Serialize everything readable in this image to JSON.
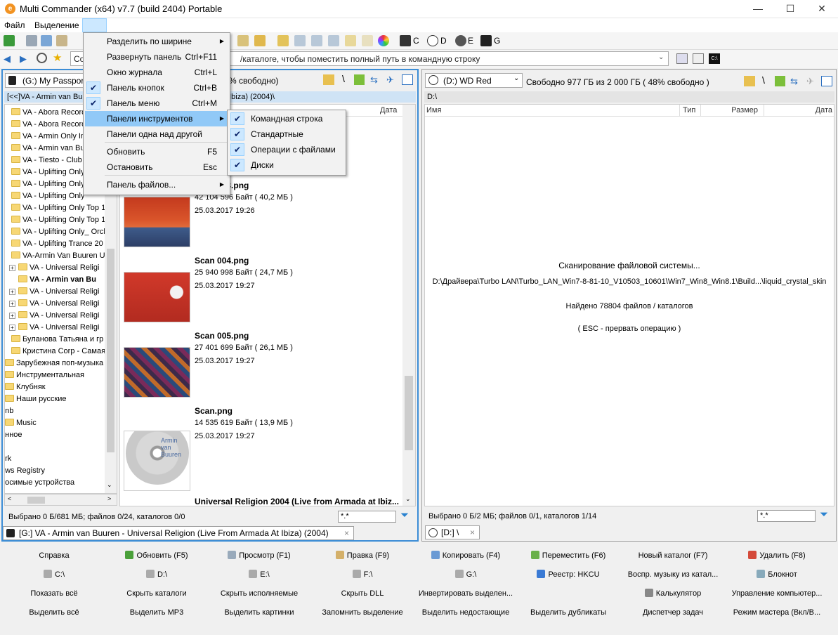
{
  "window": {
    "title": "Multi Commander (x64)  v7.7 (build 2404) Portable",
    "minimize": "—",
    "maximize": "☐",
    "close": "✕"
  },
  "menubar": {
    "file": "Файл",
    "selection": "Выделение"
  },
  "toolbar": {
    "drives": [
      "C",
      "D",
      "E",
      "G"
    ]
  },
  "cmdline": {
    "text": "Co",
    "hint": "/каталоге, чтобы поместить полный путь в командную строку"
  },
  "left": {
    "drive": "(G:) My Passport",
    "free": "% свободно)",
    "path_prefix": "[<<]VA - Armin van Bu",
    "path_suffix": "t Ibiza) (2004)\\",
    "col_date": "Дата",
    "tree": [
      {
        "label": "VA - Abora Record",
        "indent": 1
      },
      {
        "label": "VA - Abora Record",
        "indent": 1
      },
      {
        "label": "VA - Armin Only Int",
        "indent": 1
      },
      {
        "label": "VA - Armin van Bu",
        "indent": 1
      },
      {
        "label": "VA - Tiesto - Club L",
        "indent": 1
      },
      {
        "label": "VA - Uplifting Only",
        "indent": 1
      },
      {
        "label": "VA - Uplifting Only",
        "indent": 1
      },
      {
        "label": "VA - Uplifting Only",
        "indent": 1
      },
      {
        "label": "VA - Uplifting Only Top 1",
        "indent": 1
      },
      {
        "label": "VA - Uplifting Only Top 1",
        "indent": 1
      },
      {
        "label": "VA - Uplifting Only_ Orch",
        "indent": 1
      },
      {
        "label": "VA - Uplifting Trance 20",
        "indent": 1
      },
      {
        "label": "VA-Armin Van Buuren Ui",
        "indent": 1
      },
      {
        "label": "VA  - Universal Religi",
        "indent": 2,
        "plus": true
      },
      {
        "label": "VA - Armin van Bu",
        "indent": 2,
        "bold": true
      },
      {
        "label": "VA - Universal Religi",
        "indent": 2,
        "plus": true
      },
      {
        "label": "VA - Universal Religi",
        "indent": 2,
        "plus": true
      },
      {
        "label": "VA - Universal Religi",
        "indent": 2,
        "plus": true
      },
      {
        "label": "VA - Universal Religi",
        "indent": 2,
        "plus": true
      },
      {
        "label": "Буланова Татьяна и гр",
        "indent": 1
      },
      {
        "label": "Кристина Corp -  Самая",
        "indent": 1
      },
      {
        "label": "Зарубежная поп-музыка",
        "indent": 0
      },
      {
        "label": "Инструментальная",
        "indent": 0
      },
      {
        "label": "Клубняк",
        "indent": 0
      },
      {
        "label": "Наши русские",
        "indent": 0
      },
      {
        "label": "enb",
        "indent": -1
      },
      {
        "label": "Music",
        "indent": 0
      },
      {
        "label": "анное",
        "indent": -1
      },
      {
        "label": "",
        "indent": -1
      },
      {
        "label": "ork",
        "indent": -1
      },
      {
        "label": "ows Registry",
        "indent": -1
      },
      {
        "label": "носимые устройства",
        "indent": -1
      }
    ],
    "files": [
      {
        "name": "Scan 003.png",
        "size": "42 104 596 Байт ( 40,2 МБ )",
        "date": "25.03.2017 19:26",
        "thumb": "red"
      },
      {
        "name": "Scan 004.png",
        "size": "25 940 998 Байт ( 24,7 МБ )",
        "date": "25.03.2017 19:27",
        "thumb": "redbook"
      },
      {
        "name": "Scan 005.png",
        "size": "27 401 699 Байт ( 26,1 МБ )",
        "date": "25.03.2017 19:27",
        "thumb": "collage"
      },
      {
        "name": "Scan.png",
        "size": "14 535 619 Байт ( 13,9 МБ )",
        "date": "25.03.2017 19:27",
        "thumb": "cd"
      }
    ],
    "cd_text": "Armin van Buuren",
    "last_file": "Universal Religion 2004 (Live from Armada at Ibiz...",
    "status": "Выбрано 0 Б/681 МБ; файлов 0/24, каталогов 0/0",
    "filter": "*.*",
    "tab": "[G:] VA - Armin van Buuren - Universal Religion (Live From Armada At Ibiza) (2004)",
    "tab_close": "×"
  },
  "right": {
    "drive": "(D:) WD Red",
    "free": "Свободно 977 ГБ из 2 000 ГБ ( 48% свободно )",
    "path": "D:\\",
    "col_name": "Имя",
    "col_type": "Тип",
    "col_size": "Размер",
    "col_date": "Дата",
    "scan_title": "Сканирование файловой системы...",
    "scan_path": "D:\\Драйвера\\Turbo LAN\\Turbo_LAN_Win7-8-81-10_V10503_10601\\Win7_Win8_Win8.1\\Build...\\liquid_crystal_skin",
    "scan_found": "Найдено 78804 файлов / каталогов",
    "scan_esc": "( ESC - прервать операцию )",
    "status": "Выбрано 0 Б/2 МБ; файлов 0/1, каталогов 1/14",
    "filter": "*.*",
    "tab": "[D:] \\",
    "tab_close": "×"
  },
  "fnbar": {
    "rows": [
      [
        "Справка",
        "Обновить (F5)",
        "Просмотр (F1)",
        "Правка (F9)",
        "Копировать (F4)",
        "Переместить (F6)",
        "Новый каталог (F7)",
        "Удалить (F8)"
      ],
      [
        "C:\\",
        "D:\\",
        "E:\\",
        "F:\\",
        "G:\\",
        "Реестр: HKCU",
        "Воспр. музыку из катал...",
        "Блокнот"
      ],
      [
        "Показать всё",
        "Скрыть каталоги",
        "Скрыть исполняемые",
        "Скрыть DLL",
        "Инвертировать выделен...",
        "",
        "Калькулятор",
        "Управление компьютер..."
      ],
      [
        "Выделить всё",
        "Выделить MP3",
        "Выделить картинки",
        "Запомнить выделение",
        "Выделить недостающие",
        "Выделить дубликаты",
        "Диспетчер задач",
        "Режим мастера (Вкл/В..."
      ]
    ]
  },
  "menu": {
    "items": [
      {
        "label": "Разделить по ширине",
        "shortcut": "",
        "checked": false,
        "submenu": true
      },
      {
        "label": "Развернуть панель",
        "shortcut": "Ctrl+F11",
        "checked": false
      },
      {
        "label": "Окно журнала",
        "shortcut": "Ctrl+L",
        "checked": false
      },
      {
        "label": "Панель кнопок",
        "shortcut": "Ctrl+B",
        "checked": true
      },
      {
        "label": "Панель меню",
        "shortcut": "Ctrl+M",
        "checked": true
      },
      {
        "label": "Панели инструментов",
        "shortcut": "",
        "checked": false,
        "submenu": true,
        "highlight": true
      },
      {
        "label": "Панели одна над другой",
        "shortcut": "",
        "checked": false
      },
      {
        "label": "Обновить",
        "shortcut": "F5",
        "checked": false
      },
      {
        "label": "Остановить",
        "shortcut": "Esc",
        "checked": false
      },
      {
        "label": "Панель файлов...",
        "shortcut": "",
        "checked": false,
        "submenu": true
      }
    ],
    "check_glyph": "✔",
    "arrow_glyph": "▶"
  },
  "submenu": {
    "items": [
      "Командная строка",
      "Стандартные",
      "Операции с файлами",
      "Диски"
    ]
  }
}
